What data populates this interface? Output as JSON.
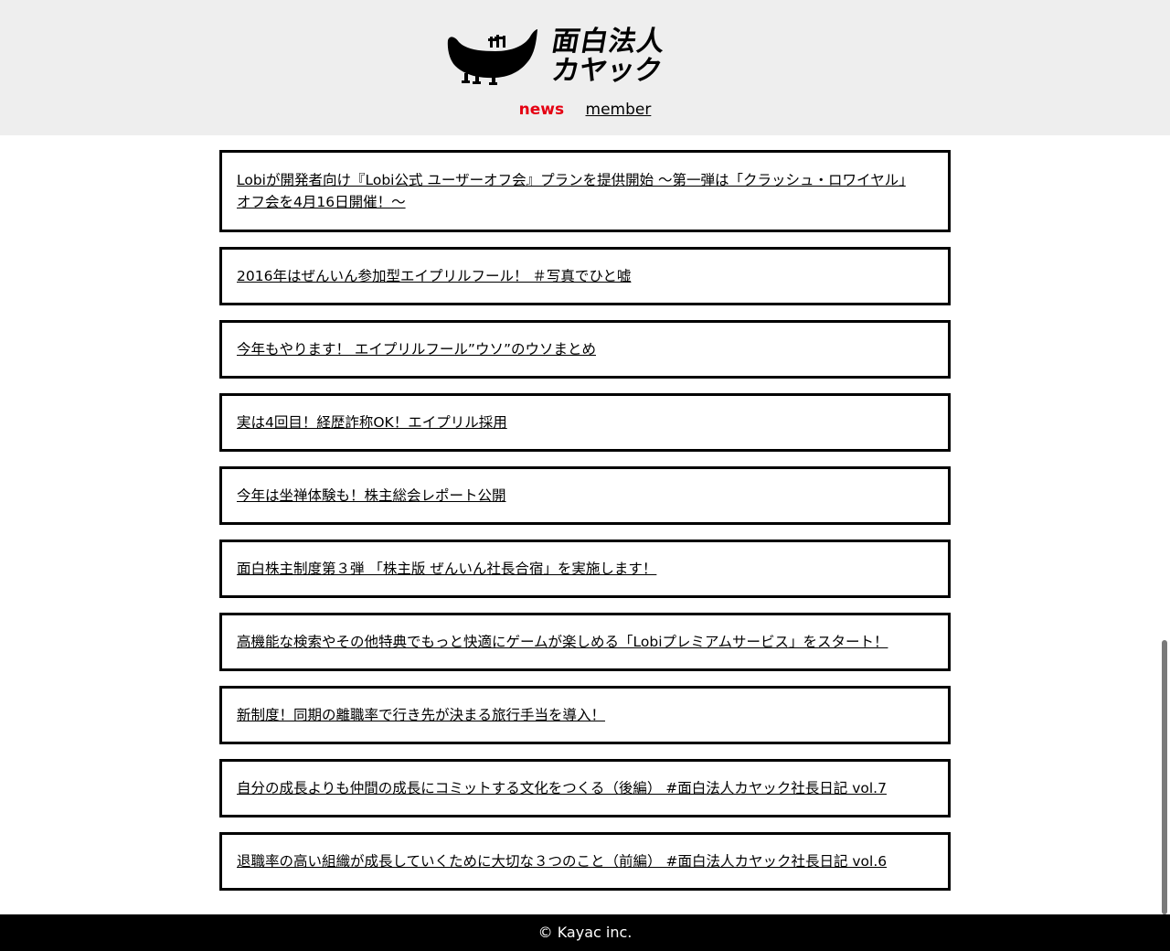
{
  "header": {
    "logo_line1": "面白法人",
    "logo_line2": "カヤック",
    "nav": [
      {
        "label": "news",
        "active": true
      },
      {
        "label": "member",
        "active": false
      }
    ]
  },
  "news": [
    "Lobiが開発者向け『Lobi公式 ユーザーオフ会』プランを提供開始 〜第一弾は「クラッシュ・ロワイヤル」オフ会を4月16日開催！〜",
    "2016年はぜんいん参加型エイプリルフール！ ＃写真でひと嘘",
    "今年もやります！ エイプリルフール”ウソ”のウソまとめ",
    "実は4回目！経歴詐称OK！エイプリル採用",
    "今年は坐禅体験も！株主総会レポート公開",
    "面白株主制度第３弾 「株主版 ぜんいん社長合宿」を実施します！",
    "高機能な検索やその他特典でもっと快適にゲームが楽しめる「Lobiプレミアムサービス」をスタート！",
    "新制度！同期の離職率で行き先が決まる旅行手当を導入！",
    "自分の成長よりも仲間の成長にコミットする文化をつくる（後編） #面白法人カヤック社長日記 vol.7",
    "退職率の高い組織が成長していくために大切な３つのこと（前編） #面白法人カヤック社長日記 vol.6"
  ],
  "footer": {
    "copyright": "© Kayac inc."
  },
  "colors": {
    "header_bg": "#eeeeee",
    "accent": "#e50012",
    "footer_bg": "#000000"
  }
}
